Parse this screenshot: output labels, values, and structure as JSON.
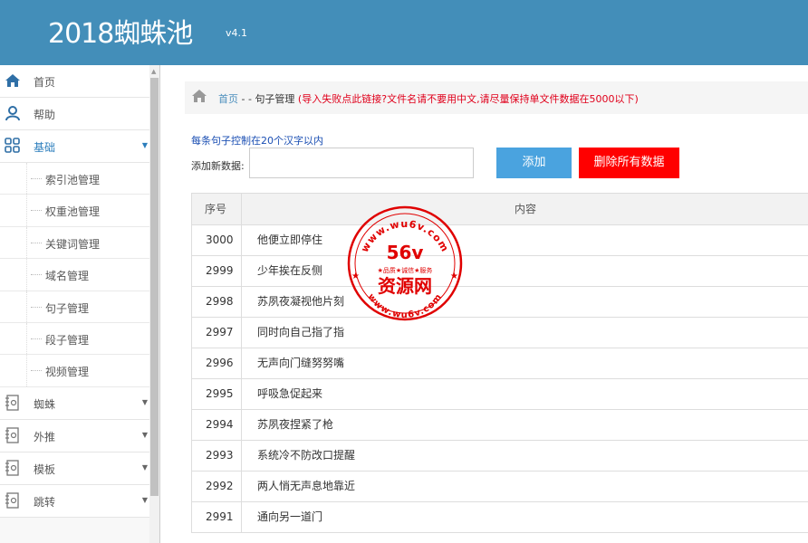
{
  "header": {
    "title": "2018蜘蛛池",
    "version": "v4.1"
  },
  "sidebar": {
    "items": [
      {
        "label": "首页",
        "icon": "home-icon"
      },
      {
        "label": "帮助",
        "icon": "user-icon"
      },
      {
        "label": "基础",
        "icon": "grid-icon",
        "open": true
      }
    ],
    "sub_items": [
      {
        "label": "索引池管理"
      },
      {
        "label": "权重池管理"
      },
      {
        "label": "关键词管理"
      },
      {
        "label": "域名管理"
      },
      {
        "label": "句子管理"
      },
      {
        "label": "段子管理"
      },
      {
        "label": "视频管理"
      }
    ],
    "more_items": [
      {
        "label": "蜘蛛",
        "icon": "notebook-icon"
      },
      {
        "label": "外推",
        "icon": "notebook-icon"
      },
      {
        "label": "模板",
        "icon": "notebook-icon"
      },
      {
        "label": "跳转",
        "icon": "notebook-icon"
      }
    ]
  },
  "breadcrumb": {
    "home": "首页",
    "separator": " - - ",
    "current": "句子管理",
    "warning": " (导入失败点此链接?文件名请不要用中文,请尽量保持单文件数据在5000以下)"
  },
  "form": {
    "hint": "每条句子控制在20个汉字以内",
    "add_label": "添加新数据:",
    "input_value": "",
    "add_button": "添加",
    "delete_all_button": "删除所有数据"
  },
  "table": {
    "headers": [
      "序号",
      "内容"
    ],
    "rows": [
      {
        "id": "3000",
        "text": "他便立即停住"
      },
      {
        "id": "2999",
        "text": "少年挨在反侧"
      },
      {
        "id": "2998",
        "text": "苏夙夜凝视他片刻"
      },
      {
        "id": "2997",
        "text": "同时向自己指了指"
      },
      {
        "id": "2996",
        "text": "无声向门缝努努嘴"
      },
      {
        "id": "2995",
        "text": "呼吸急促起来"
      },
      {
        "id": "2994",
        "text": "苏夙夜捏紧了枪"
      },
      {
        "id": "2993",
        "text": "系统冷不防改口提醒"
      },
      {
        "id": "2992",
        "text": "两人悄无声息地靠近"
      },
      {
        "id": "2991",
        "text": "通向另一道门"
      }
    ]
  },
  "watermark": {
    "url_top": "www.wu6v.com",
    "brand": "56v",
    "slogan": "★品质★诚信★服务",
    "name": "资源网",
    "url_bottom": "www.wu6v.com"
  },
  "colors": {
    "header_bg": "#438eb9",
    "add_button": "#4aa3df",
    "delete_button": "#ff0000",
    "warning_text": "#e0001b",
    "watermark": "#e00000"
  }
}
